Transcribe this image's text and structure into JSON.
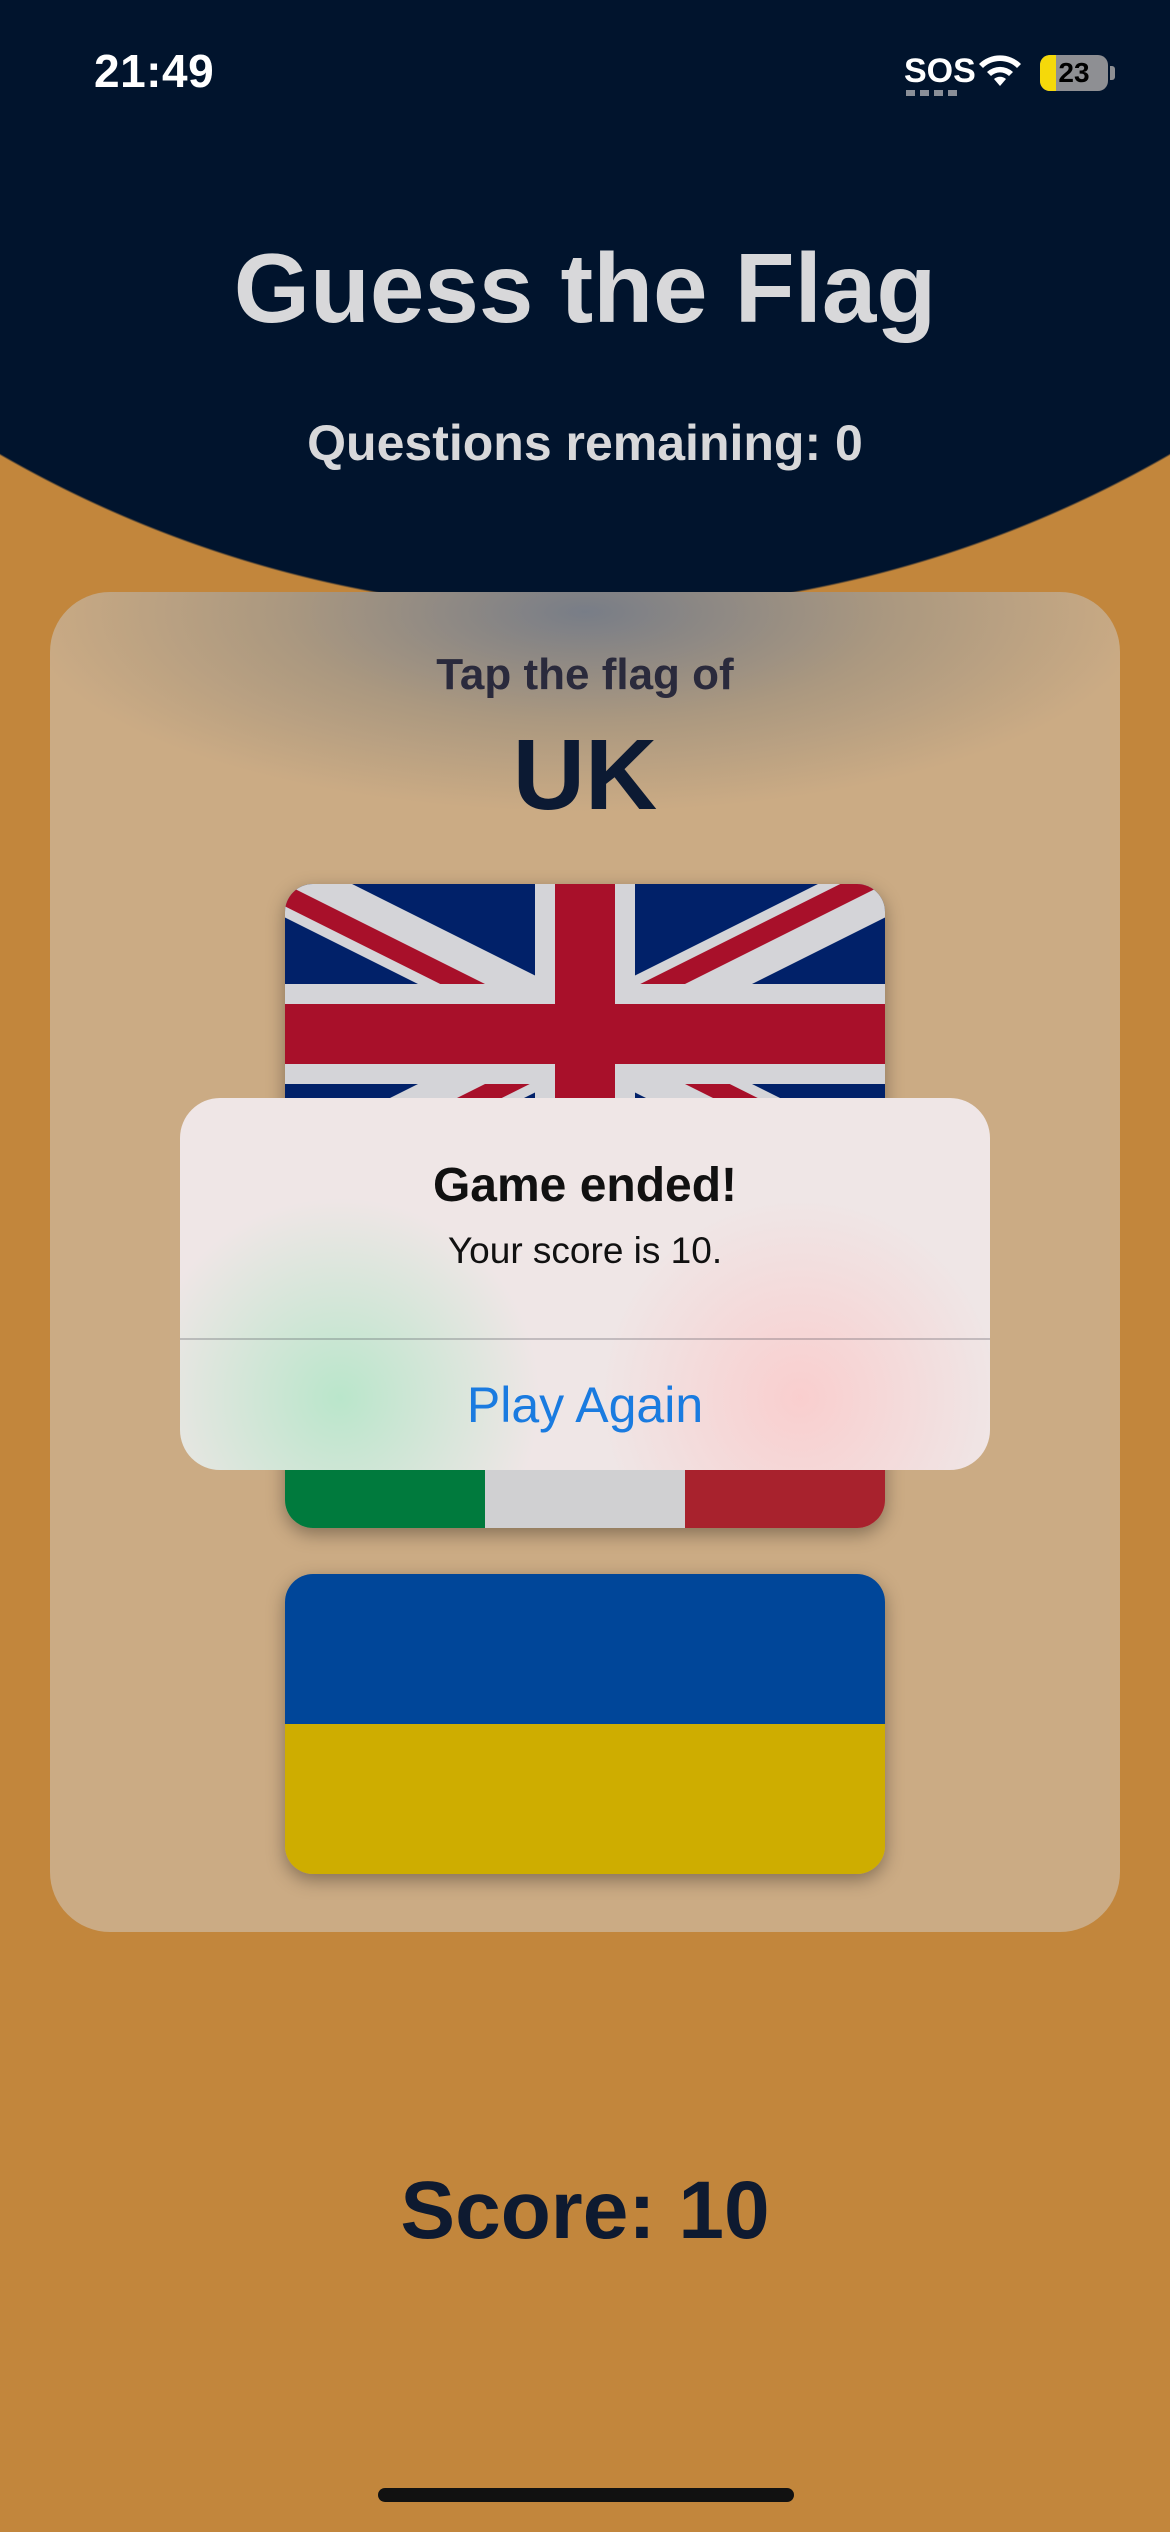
{
  "status_bar": {
    "time": "21:49",
    "carrier": "SOS",
    "battery_level": "23"
  },
  "header": {
    "title": "Guess the Flag",
    "questions_remaining": "Questions remaining: 0"
  },
  "prompt": {
    "label": "Tap the flag of",
    "country": "UK"
  },
  "flags": [
    {
      "country": "UK",
      "icon": "uk-flag"
    },
    {
      "country": "Italy",
      "icon": "italy-flag"
    },
    {
      "country": "Ukraine",
      "icon": "ukraine-flag"
    }
  ],
  "alert": {
    "title": "Game ended!",
    "message": "Your score is 10.",
    "button_label": "Play Again"
  },
  "score": {
    "label": "Score: 10"
  },
  "colors": {
    "header_bg": "#01142d",
    "page_bg": "#c2863c",
    "card_bg": "#cbab84",
    "accent_blue": "#1a7be0"
  }
}
